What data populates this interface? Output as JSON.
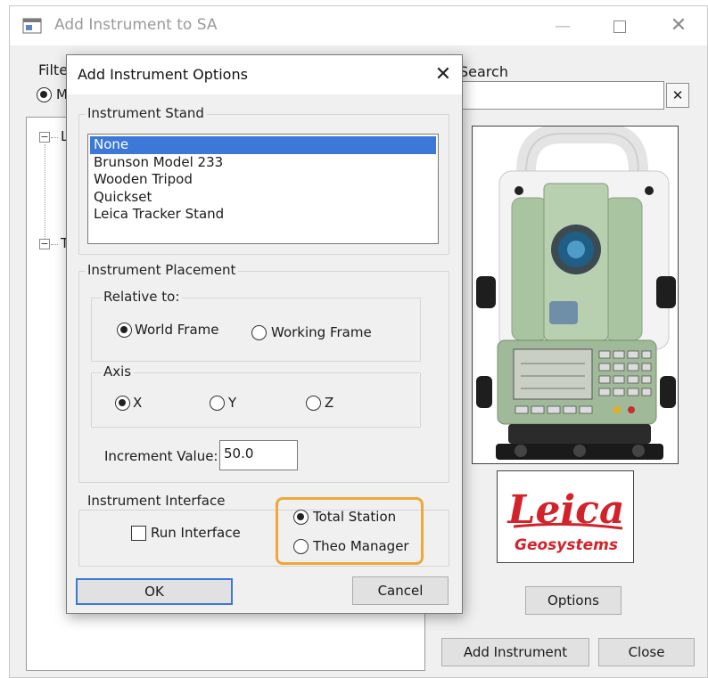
{
  "main_window": {
    "title": "Add Instrument to SA",
    "filter_label": "Filter",
    "filter_radio_text": "M",
    "search_label": "Search",
    "search_value": "",
    "search_clear": "✕",
    "tree_items": [
      "L",
      "T"
    ],
    "options_button": "Options",
    "add_instrument_button": "Add Instrument",
    "close_button": "Close",
    "logo": {
      "brand": "Leica",
      "sub": "Geosystems"
    }
  },
  "dialog": {
    "title": "Add Instrument Options",
    "close_glyph": "✕",
    "instrument_stand": {
      "legend": "Instrument Stand",
      "items": [
        "None",
        "Brunson Model 233",
        "Wooden Tripod",
        "Quickset",
        "Leica Tracker Stand"
      ],
      "selected_index": 0
    },
    "instrument_placement": {
      "legend": "Instrument Placement",
      "relative_to": {
        "legend": "Relative to:",
        "options": [
          "World Frame",
          "Working Frame"
        ],
        "selected_index": 0
      },
      "axis": {
        "legend": "Axis",
        "options": [
          "X",
          "Y",
          "Z"
        ],
        "selected_index": 0
      },
      "increment_label": "Increment Value:",
      "increment_value": "50.0"
    },
    "instrument_interface": {
      "legend": "Instrument Interface",
      "run_interface_label": "Run Interface",
      "run_interface_checked": false,
      "options": [
        "Total Station",
        "Theo Manager"
      ],
      "selected_index": 0
    },
    "ok_button": "OK",
    "cancel_button": "Cancel"
  },
  "colors": {
    "selection": "#3b78d8",
    "highlight": "#f0a73a",
    "leica_red": "#d2232a",
    "instrument_green": "#a9c4a0"
  }
}
